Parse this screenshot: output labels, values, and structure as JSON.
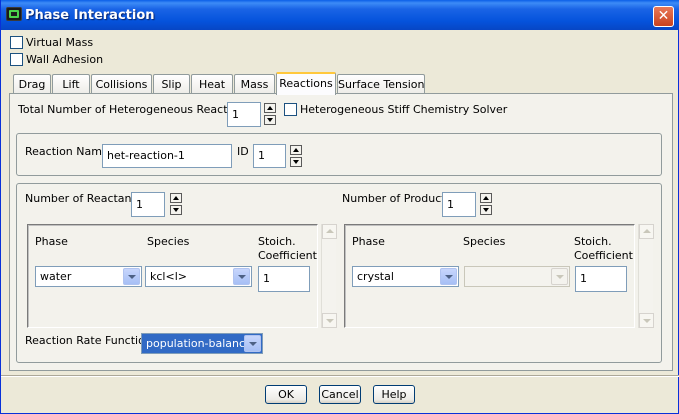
{
  "window": {
    "title": "Phase Interaction",
    "close_glyph": "✕"
  },
  "options": {
    "virtual_mass": {
      "label": "Virtual Mass",
      "checked": false
    },
    "wall_adhesion": {
      "label": "Wall Adhesion",
      "checked": false
    }
  },
  "tabs": [
    {
      "label": "Drag",
      "active": false
    },
    {
      "label": "Lift",
      "active": false
    },
    {
      "label": "Collisions",
      "active": false
    },
    {
      "label": "Slip",
      "active": false
    },
    {
      "label": "Heat",
      "active": false
    },
    {
      "label": "Mass",
      "active": false
    },
    {
      "label": "Reactions",
      "active": true
    },
    {
      "label": "Surface Tension",
      "active": false
    }
  ],
  "reactions": {
    "total_label": "Total Number of Heterogeneous Reactions",
    "total_value": "1",
    "stiff_solver_label": "Heterogeneous Stiff Chemistry Solver",
    "stiff_solver_checked": false,
    "reaction_name_label": "Reaction Name",
    "reaction_name_value": "het-reaction-1",
    "id_label": "ID",
    "id_value": "1"
  },
  "reactants": {
    "count_label": "Number of Reactants",
    "count_value": "1",
    "col_phase": "Phase",
    "col_species": "Species",
    "col_coeff": "Stoich.\nCoefficient",
    "row": {
      "phase": "water",
      "species": "kcl<l>",
      "coeff": "1"
    }
  },
  "products": {
    "count_label": "Number of Products",
    "count_value": "1",
    "col_phase": "Phase",
    "col_species": "Species",
    "col_coeff": "Stoich.\nCoefficient",
    "row": {
      "phase": "crystal",
      "species": "",
      "coeff": "1"
    }
  },
  "rate_function": {
    "label": "Reaction Rate Function",
    "value": "population-balance"
  },
  "buttons": {
    "ok": "OK",
    "cancel": "Cancel",
    "help": "Help"
  },
  "colors": {
    "title_bar": "#0553dc",
    "dialog_bg": "#ece9d8",
    "selection": "#316ac5",
    "active_tab_accent": "#ffc83c"
  },
  "icons": [
    "app-icon",
    "close-icon",
    "spinner-up-icon",
    "spinner-down-icon",
    "dropdown-arrow-icon",
    "scroll-up-icon",
    "scroll-down-icon"
  ]
}
